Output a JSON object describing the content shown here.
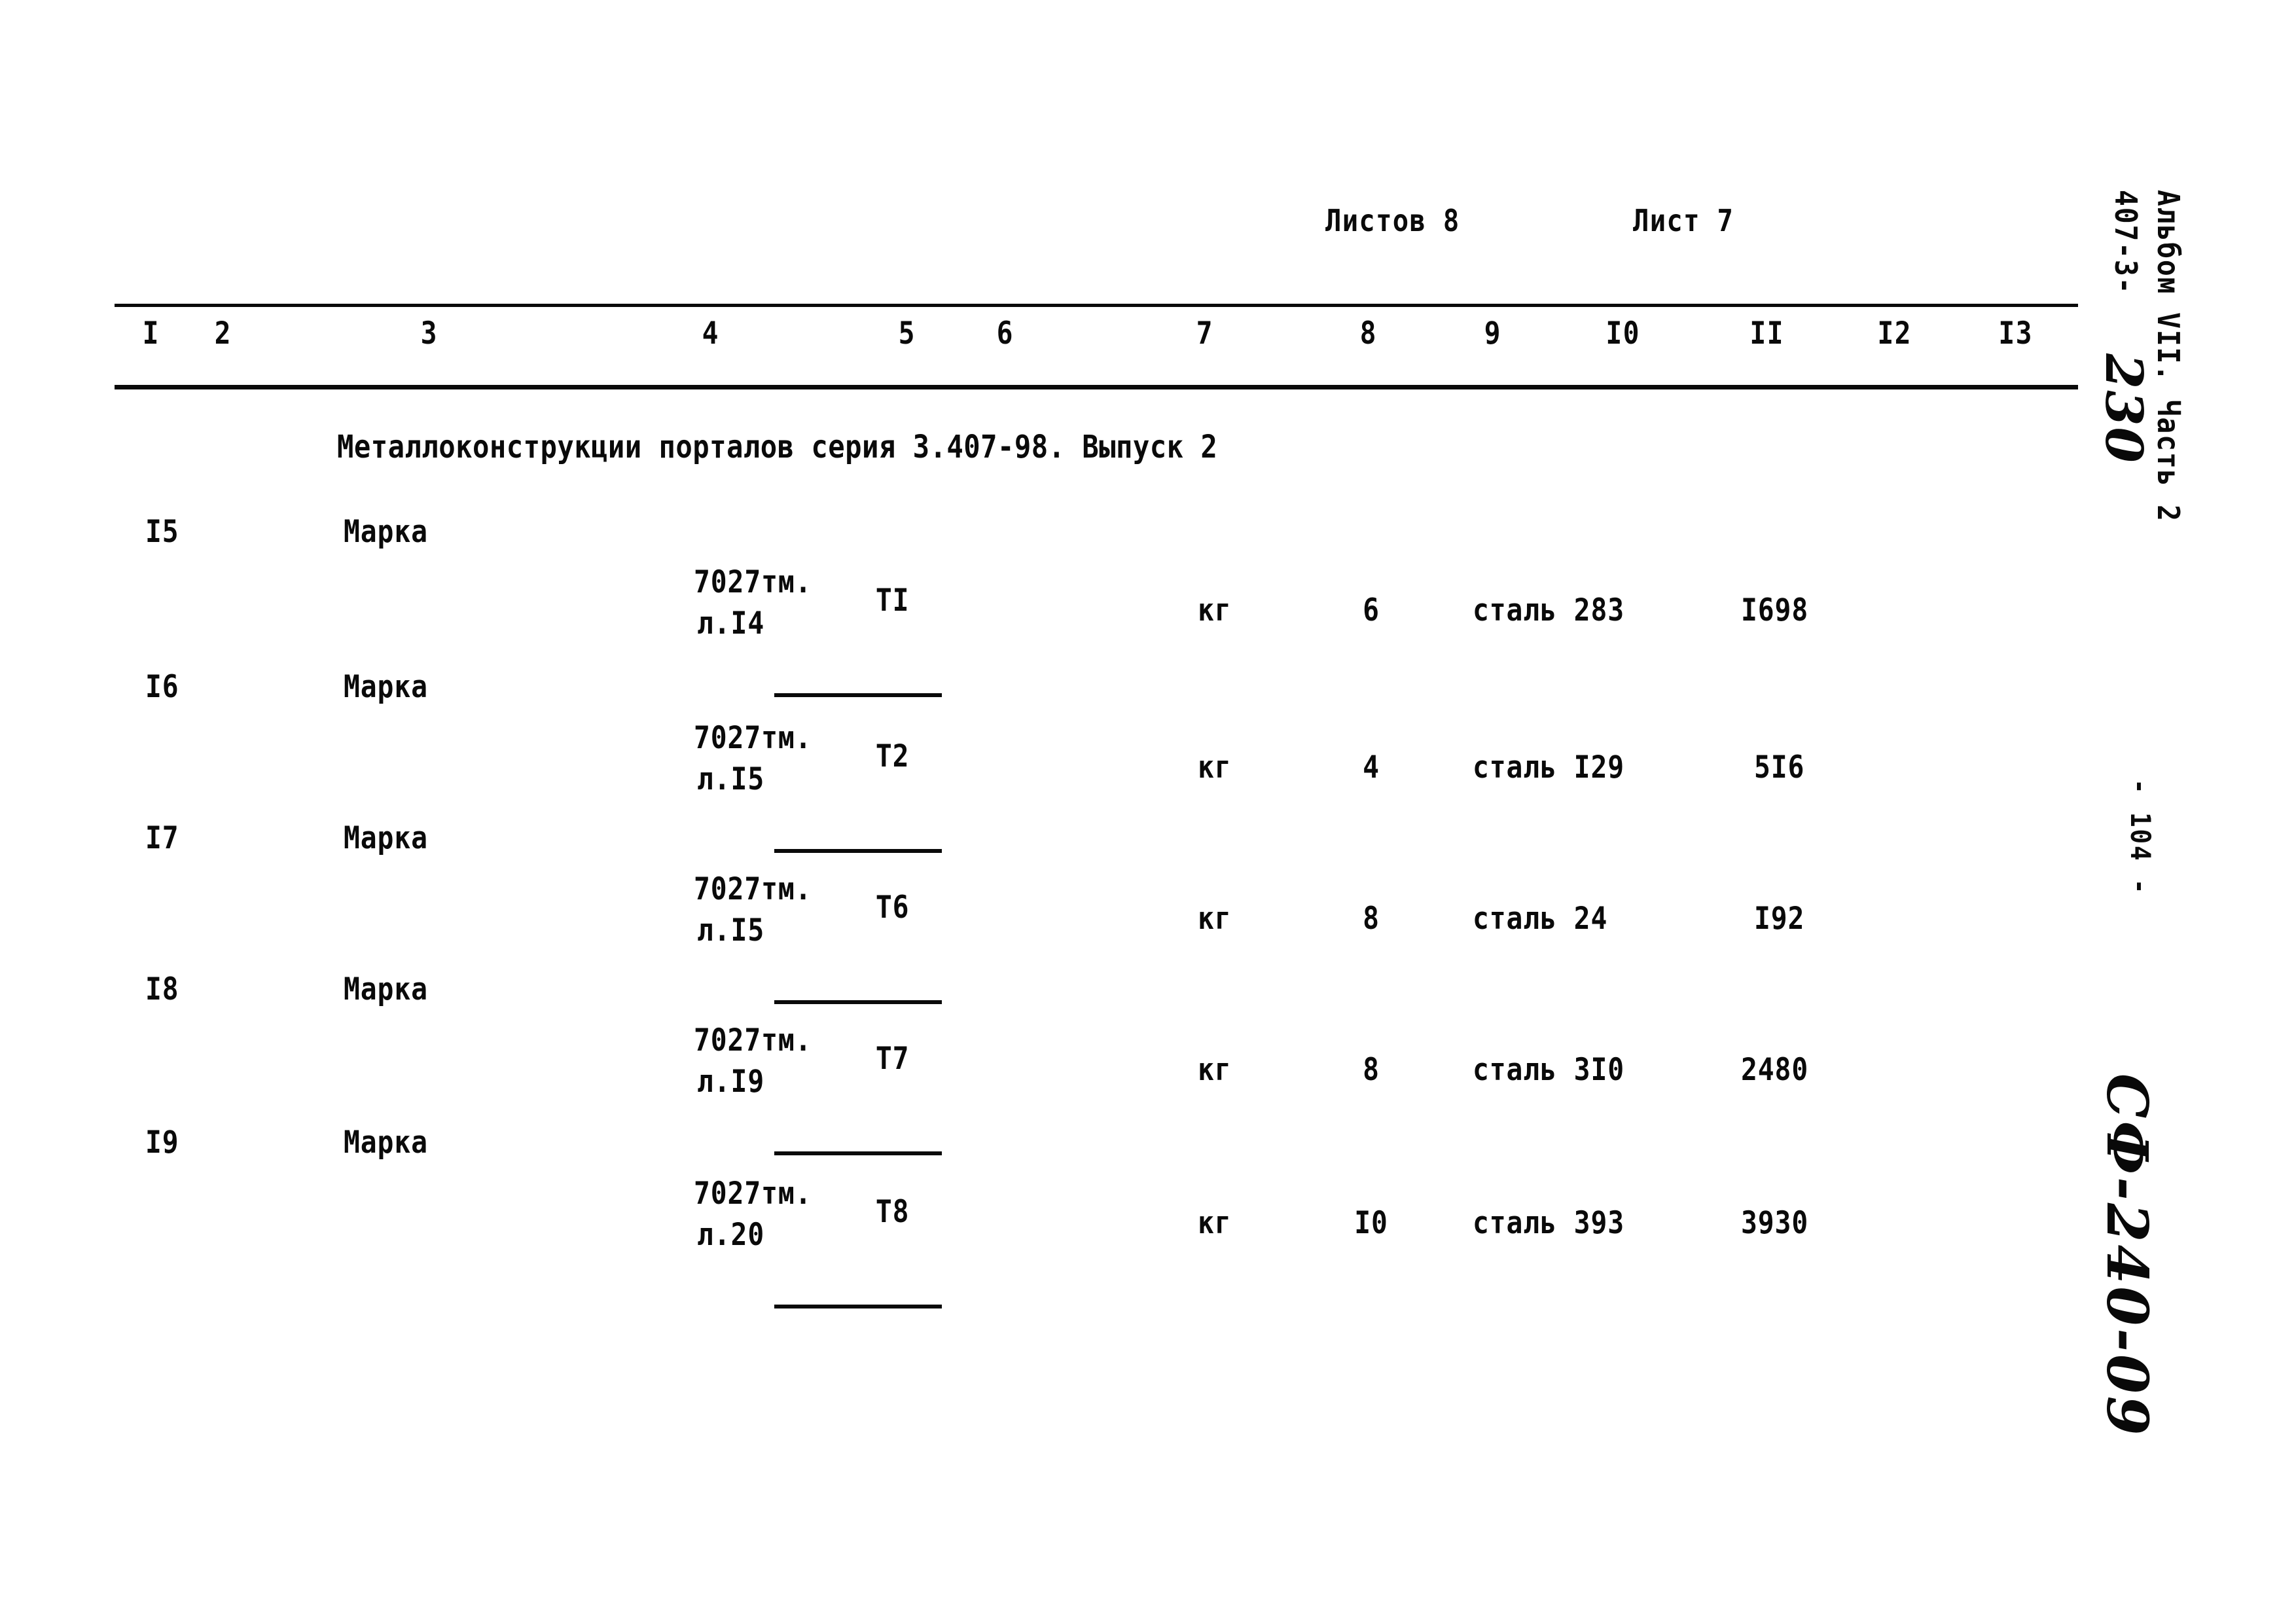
{
  "sheet_header": {
    "sheets_total_label": "Листов 8",
    "sheet_current_label": "Лист 7"
  },
  "table": {
    "column_numbers": [
      "I",
      "2",
      "3",
      "4",
      "5",
      "6",
      "7",
      "8",
      "9",
      "I0",
      "II",
      "I2",
      "I3"
    ],
    "section_title": "Металлоконструкции порталов серия 3.407-98. Выпуск 2",
    "rows": [
      {
        "num": "I5",
        "type": "Марка",
        "code": "ТI",
        "doc": "7027тм.",
        "sheet": "л.I4",
        "unit": "кг",
        "qty": "6",
        "material": "сталь 283",
        "mass": "I698"
      },
      {
        "num": "I6",
        "type": "Марка",
        "code": "Т2",
        "doc": "7027тм.",
        "sheet": "л.I5",
        "unit": "кг",
        "qty": "4",
        "material": "сталь I29",
        "mass": "5I6"
      },
      {
        "num": "I7",
        "type": "Марка",
        "code": "Т6",
        "doc": "7027тм.",
        "sheet": "л.I5",
        "unit": "кг",
        "qty": "8",
        "material": "сталь 24",
        "mass": "I92"
      },
      {
        "num": "I8",
        "type": "Марка",
        "code": "Т7",
        "doc": "7027тм.",
        "sheet": "л.I9",
        "unit": "кг",
        "qty": "8",
        "material": "сталь 3I0",
        "mass": "2480"
      },
      {
        "num": "I9",
        "type": "Марка",
        "code": "Т8",
        "doc": "7027тм.",
        "sheet": "л.20",
        "unit": "кг",
        "qty": "I0",
        "material": "сталь 393",
        "mass": "3930"
      }
    ]
  },
  "margin": {
    "series_code": "407-3-",
    "series_handwritten": "230",
    "album_part": "Альбом VII. Часть 2",
    "page_number": "- 104 -",
    "archive_code": "СФ-240-09"
  }
}
